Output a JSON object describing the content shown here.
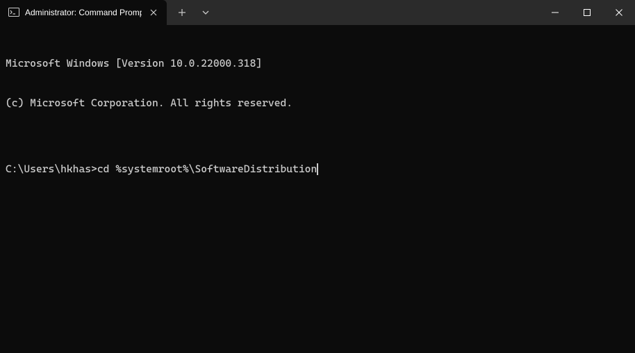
{
  "titlebar": {
    "tab_title": "Administrator: Command Prompt"
  },
  "terminal": {
    "line1": "Microsoft Windows [Version 10.0.22000.318]",
    "line2": "(c) Microsoft Corporation. All rights reserved.",
    "blank": "",
    "prompt": "C:\\Users\\hkhas>",
    "command": "cd %systemroot%\\SoftwareDistribution"
  },
  "icons": {
    "tab": "cmd-icon",
    "close": "close-icon",
    "newtab": "plus-icon",
    "dropdown": "chevron-down-icon",
    "minimize": "minimize-icon",
    "maximize": "maximize-icon",
    "windowClose": "close-icon"
  }
}
